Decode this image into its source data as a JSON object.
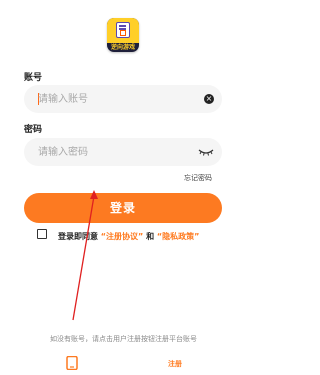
{
  "app": {
    "logo_text": "逆向游戏",
    "accent_color": "#fd7a21"
  },
  "account": {
    "label": "账号",
    "placeholder": "请输入账号",
    "value": "",
    "clear_icon": "clear-icon"
  },
  "password": {
    "label": "密码",
    "placeholder": "请输入密码",
    "value": "",
    "visibility_icon": "eye-closed-icon"
  },
  "forgot_password": "忘记密码",
  "login_button": "登录",
  "agreement": {
    "checked": false,
    "prefix": "登录即同意",
    "terms_link": "“注册协议”",
    "and": "和",
    "privacy_link": "“隐私政策”"
  },
  "footer": {
    "hint": "如没有账号，请点击用户注册按钮注册平台账号",
    "phone_icon": "phone-icon",
    "register_label": "注册"
  }
}
